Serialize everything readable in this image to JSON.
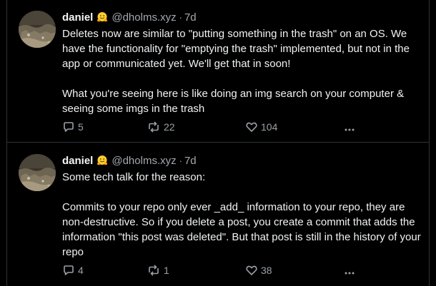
{
  "posts": [
    {
      "author": {
        "display_name": "daniel",
        "emoji": "hugging-face-emoji",
        "handle": "@dholms.xyz",
        "separator": "·",
        "time": "7d"
      },
      "text": "Deletes now are similar to \"putting something in the trash\" on an OS. We have the functionality for \"emptying the trash\" implemented, but not in the app or communicated yet. We'll get that in soon!\n\nWhat you're seeing here is like doing an img search on your computer & seeing some imgs in the trash",
      "actions": {
        "reply_count": "5",
        "repost_count": "22",
        "like_count": "104"
      }
    },
    {
      "author": {
        "display_name": "daniel",
        "emoji": "hugging-face-emoji",
        "handle": "@dholms.xyz",
        "separator": "·",
        "time": "7d"
      },
      "text": "Some tech talk for the reason:\n\nCommits to your repo only ever _add_ information to your repo, they are non-destructive. So if you delete a post, you create a commit that adds the information \"this post was deleted\". But that post is still in the history of your repo",
      "actions": {
        "reply_count": "4",
        "repost_count": "1",
        "like_count": "38"
      }
    }
  ],
  "icons": {
    "reply": "reply-icon",
    "repost": "repost-icon",
    "like": "heart-icon",
    "more": "more-options-icon"
  },
  "colors": {
    "background": "#000000",
    "text": "#f0f2f4",
    "muted": "#9aa0a6",
    "divider": "#2f3336"
  }
}
